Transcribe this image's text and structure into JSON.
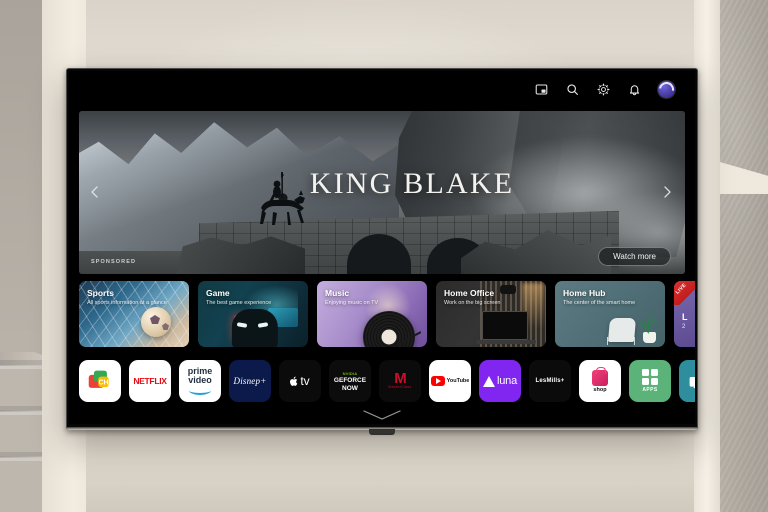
{
  "scene": {
    "description": "Wall-mounted TV showing webOS-style home screen in a beige room"
  },
  "topbar": {
    "icons": [
      {
        "name": "multi-view-icon",
        "glyph": "multiview"
      },
      {
        "name": "search-icon",
        "glyph": "search"
      },
      {
        "name": "settings-gear-icon",
        "glyph": "gear"
      },
      {
        "name": "notification-bell-icon",
        "glyph": "bell"
      },
      {
        "name": "profile-avatar",
        "glyph": "avatar"
      }
    ]
  },
  "hero": {
    "title": "KING BLAKE",
    "sponsored_label": "SPONSORED",
    "watch_more_label": "Watch more",
    "prev_arrow": "‹",
    "next_arrow": "›"
  },
  "cards": [
    {
      "title": "Sports",
      "subtitle": "All sports information at a glance",
      "theme": "sports"
    },
    {
      "title": "Game",
      "subtitle": "The best game experience",
      "theme": "game"
    },
    {
      "title": "Music",
      "subtitle": "Enjoying music on TV",
      "theme": "music"
    },
    {
      "title": "Home Office",
      "subtitle": "Work on the big screen",
      "theme": "office"
    },
    {
      "title": "Home Hub",
      "subtitle": "The center of the smart home",
      "theme": "hub"
    }
  ],
  "partial_card": {
    "badge": "LIVE",
    "title": "L",
    "subtitle": "2"
  },
  "apps": [
    {
      "name": "channels",
      "label": "CH"
    },
    {
      "name": "netflix",
      "label": "NETFLIX"
    },
    {
      "name": "prime-video",
      "label_top": "prime",
      "label_bottom": "video"
    },
    {
      "name": "disney-plus",
      "label": "Disnep+"
    },
    {
      "name": "apple-tv",
      "label": "tv"
    },
    {
      "name": "geforce-now",
      "label_brand": "NVIDIA",
      "label_line1": "GEFORCE",
      "label_line2": "NOW"
    },
    {
      "name": "masterclass",
      "label_mark": "M",
      "label_text": "MasterClass"
    },
    {
      "name": "youtube",
      "label": "YouTube"
    },
    {
      "name": "luna",
      "label": "luna"
    },
    {
      "name": "lesmills",
      "label": "LesMills+"
    },
    {
      "name": "shop",
      "label": "shop"
    },
    {
      "name": "apps",
      "label": "APPS"
    },
    {
      "name": "input-source",
      "label": ""
    }
  ],
  "footer": {
    "chevron": "chevron-down"
  },
  "colors": {
    "accent_purple": "#6f64d8",
    "netflix_red": "#e50914",
    "live_red": "#e03030",
    "luna_purple": "#8126f0",
    "apps_green": "#5cb37a",
    "input_teal": "#2e8e9e"
  }
}
